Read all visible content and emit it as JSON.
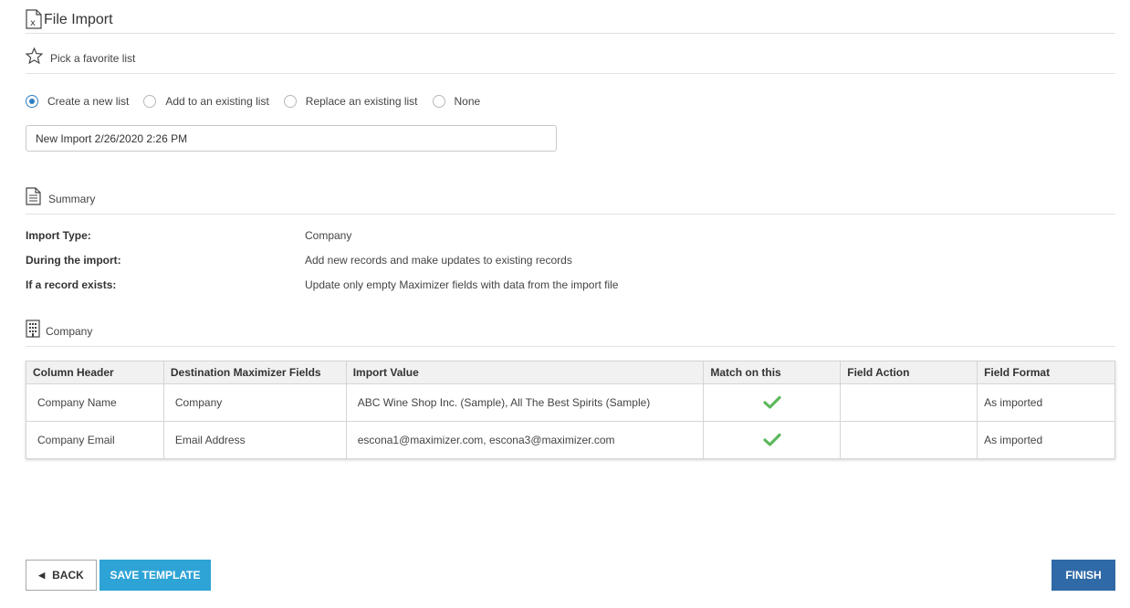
{
  "page": {
    "title": "File Import"
  },
  "favorite": {
    "label": "Pick a favorite list"
  },
  "list_options": {
    "items": [
      {
        "label": "Create a new list",
        "checked": true
      },
      {
        "label": "Add to an existing list",
        "checked": false
      },
      {
        "label": "Replace an existing list",
        "checked": false
      },
      {
        "label": "None",
        "checked": false
      }
    ]
  },
  "list_name": {
    "value": "New Import 2/26/2020 2:26 PM"
  },
  "summary": {
    "label": "Summary",
    "rows": [
      {
        "key": "Import Type:",
        "value": "Company"
      },
      {
        "key": "During the import:",
        "value": "Add new records and make updates to existing records"
      },
      {
        "key": "If a record exists:",
        "value": "Update only empty Maximizer fields with data from the import file"
      }
    ]
  },
  "company_section": {
    "label": "Company"
  },
  "mapping_table": {
    "headers": [
      "Column Header",
      "Destination Maximizer Fields",
      "Import Value",
      "Match on this",
      "Field Action",
      "Field Format"
    ],
    "rows": [
      {
        "column_header": "Company Name",
        "destination": "Company",
        "import_value": "ABC Wine Shop Inc. (Sample), All The Best Spirits (Sample)",
        "match": true,
        "field_action": "",
        "field_format": "As imported"
      },
      {
        "column_header": "Company Email",
        "destination": "Email Address",
        "import_value": "escona1@maximizer.com, escona3@maximizer.com",
        "match": true,
        "field_action": "",
        "field_format": "As imported"
      }
    ]
  },
  "buttons": {
    "back": "BACK",
    "save_template": "SAVE TEMPLATE",
    "finish": "FINISH"
  },
  "colors": {
    "radio_accent": "#2f7fc1",
    "check_green": "#5cb85c",
    "save_button": "#2ea3d6",
    "finish_button": "#2f6aa6"
  }
}
